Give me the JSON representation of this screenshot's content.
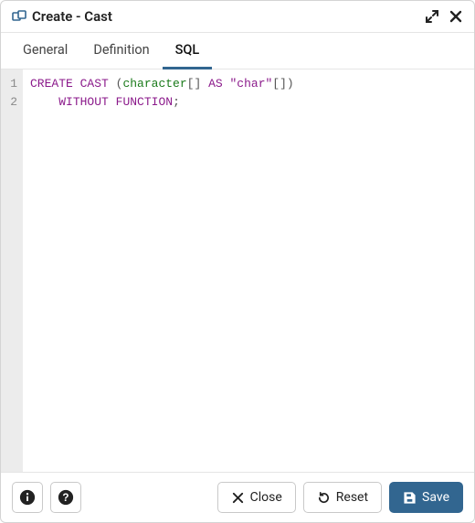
{
  "header": {
    "title": "Create - Cast"
  },
  "tabs": [
    {
      "label": "General",
      "active": false
    },
    {
      "label": "Definition",
      "active": false
    },
    {
      "label": "SQL",
      "active": true
    }
  ],
  "editor": {
    "gutter": [
      "1",
      "2"
    ],
    "lines": [
      [
        {
          "t": "CREATE",
          "c": "kw"
        },
        {
          "t": " ",
          "c": ""
        },
        {
          "t": "CAST",
          "c": "kw"
        },
        {
          "t": " (",
          "c": "punc"
        },
        {
          "t": "character",
          "c": "type"
        },
        {
          "t": "[] ",
          "c": "punc"
        },
        {
          "t": "AS",
          "c": "kw"
        },
        {
          "t": " \"char\"",
          "c": "str"
        },
        {
          "t": "[])",
          "c": "punc"
        }
      ],
      [
        {
          "t": "    ",
          "c": ""
        },
        {
          "t": "WITHOUT",
          "c": "kw"
        },
        {
          "t": " ",
          "c": ""
        },
        {
          "t": "FUNCTION",
          "c": "kw"
        },
        {
          "t": ";",
          "c": "punc"
        }
      ]
    ]
  },
  "footer": {
    "close_label": "Close",
    "reset_label": "Reset",
    "save_label": "Save"
  }
}
